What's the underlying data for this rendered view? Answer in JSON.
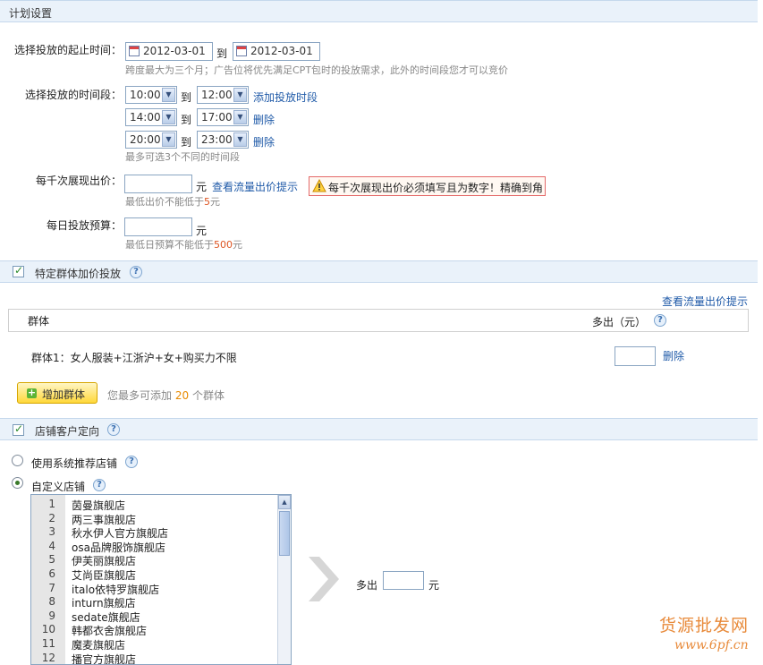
{
  "plan": {
    "title": "计划设置",
    "date_label": "选择投放的起止时间：",
    "start_date": "2012-03-01",
    "to": "到",
    "end_date": "2012-03-01",
    "date_hint": "跨度最大为三个月；广告位将优先满足CPT包时的投放需求，此外的时间段您才可以竞价",
    "period_label": "选择投放的时间段：",
    "periods": [
      {
        "from": "10:00",
        "to": "12:00",
        "action": "添加投放时段"
      },
      {
        "from": "14:00",
        "to": "17:00",
        "action": "删除"
      },
      {
        "from": "20:00",
        "to": "23:00",
        "action": "删除"
      }
    ],
    "period_hint": "最多可选3个不同的时间段",
    "cpm_label": "每千次展现出价：",
    "cpm_value": "",
    "unit_yuan": "元",
    "cpm_link": "查看流量出价提示",
    "cpm_error": "每千次展现出价必须填写且为数字！精确到角",
    "cpm_hint_pre": "最低出价不能低于",
    "cpm_min": "5",
    "budget_label": "每日投放预算：",
    "budget_value": "",
    "budget_hint_pre": "最低日预算不能低于",
    "budget_min": "500"
  },
  "crowd": {
    "checked": true,
    "title": "特定群体加价投放",
    "help": "?",
    "link": "查看流量出价提示",
    "col_group": "群体",
    "col_extra": "多出（元）",
    "rows": [
      {
        "name": "群体1：女人服装+江浙沪+女+购买力不限",
        "value": "",
        "action": "删除"
      }
    ],
    "add_button": "增加群体",
    "add_hint_pre": "您最多可添加",
    "add_max": "20",
    "add_hint_post": "个群体"
  },
  "shop": {
    "checked": true,
    "title": "店铺客户定向",
    "help": "?",
    "option_system": "使用系统推荐店铺",
    "option_custom": "自定义店铺",
    "selected_option": "custom",
    "extra_label": "多出",
    "extra_value": "",
    "unit_yuan": "元",
    "stores": [
      {
        "n": "1",
        "name": "茵曼旗舰店"
      },
      {
        "n": "2",
        "name": "两三事旗舰店"
      },
      {
        "n": "3",
        "name": "秋水伊人官方旗舰店"
      },
      {
        "n": "4",
        "name": "osa品牌服饰旗舰店"
      },
      {
        "n": "5",
        "name": "伊芙丽旗舰店"
      },
      {
        "n": "6",
        "name": "艾尚臣旗舰店"
      },
      {
        "n": "7",
        "name": "italo依特罗旗舰店"
      },
      {
        "n": "8",
        "name": "inturn旗舰店"
      },
      {
        "n": "9",
        "name": "sedate旗舰店"
      },
      {
        "n": "10",
        "name": "韩都衣舍旗舰店"
      },
      {
        "n": "11",
        "name": "魔麦旗舰店"
      },
      {
        "n": "12",
        "name": "播官方旗舰店"
      }
    ]
  },
  "watermark": {
    "line1": "货源批发网",
    "line2": "www.6pf.cn"
  }
}
